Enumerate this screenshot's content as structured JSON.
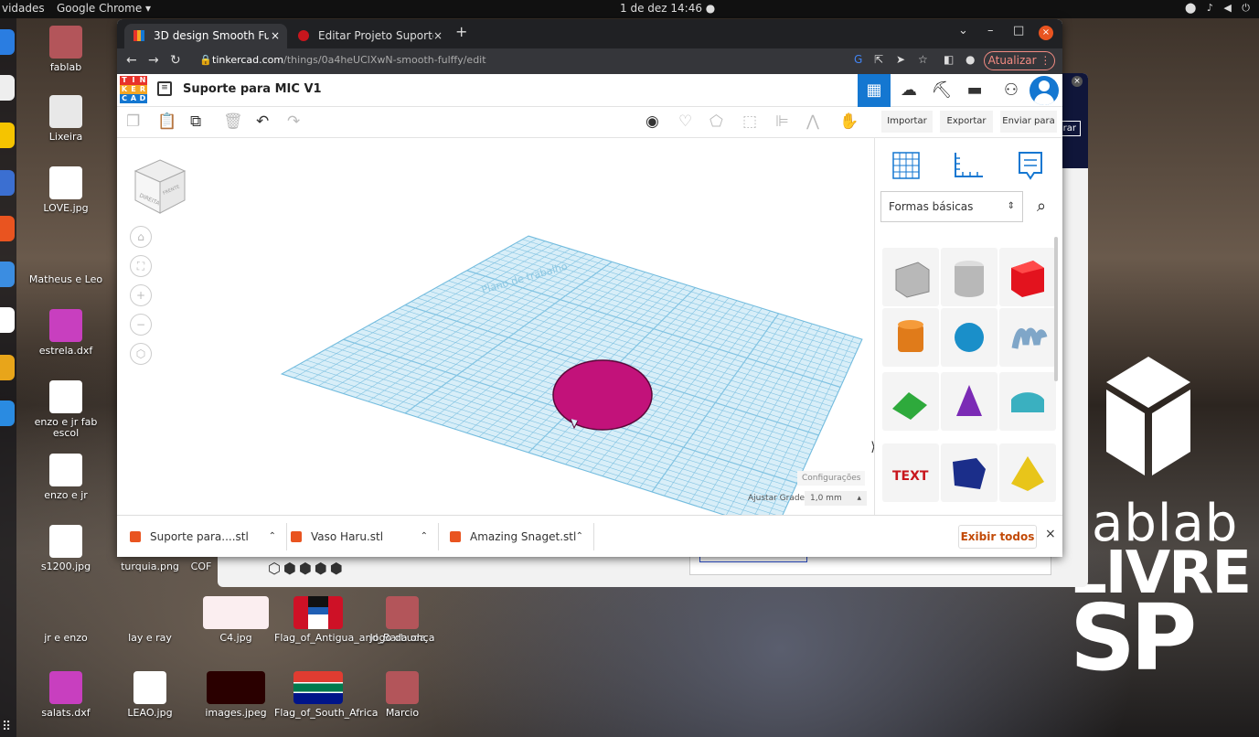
{
  "topbar": {
    "activities": "vidades",
    "app_menu": "Google Chrome ▾",
    "clock": "1 de dez  14:46  ●",
    "sys_icons": "⬤ ♪ ◀ ⏻"
  },
  "desktop_icons": [
    {
      "label": "fablab"
    },
    {
      "label": "Lixeira"
    },
    {
      "label": "LOVE.jpg"
    },
    {
      "label": "Matheus e Leo"
    },
    {
      "label": "estrela.dxf"
    },
    {
      "label": "enzo e jr fab escol"
    },
    {
      "label": "enzo e jr"
    },
    {
      "label": "s1200.jpg"
    },
    {
      "label": "turquia.png"
    },
    {
      "label": "COF"
    },
    {
      "label": "jr e enzo"
    },
    {
      "label": "lay e ray"
    },
    {
      "label": "C4.jpg"
    },
    {
      "label": "Flag_of_Antigua_and_Barbuda"
    },
    {
      "label": "Jogo da onça"
    },
    {
      "label": "salats.dxf"
    },
    {
      "label": "LEAO.jpg"
    },
    {
      "label": "images.jpeg"
    },
    {
      "label": "Flag_of_South_Africa"
    },
    {
      "label": "Marcio"
    }
  ],
  "background_window": {
    "partial_button": "rar"
  },
  "browser": {
    "tabs": [
      {
        "label": "3D design Smooth Fulffy |",
        "close": "×"
      },
      {
        "label": "Editar Projeto Suporte pa",
        "close": "×"
      }
    ],
    "new_tab": "+",
    "window_controls": {
      "dropdown": "⌄",
      "minimize": "–",
      "maximize": "□",
      "close": "×"
    },
    "url_host": "tinkercad.com",
    "url_path": "/things/0a4heUClXwN-smooth-fulffy/edit",
    "update_button": "Atualizar ⋮"
  },
  "tinkercad": {
    "logo_letters": [
      "T",
      "I",
      "N",
      "K",
      "E",
      "R",
      "C",
      "A",
      "D"
    ],
    "design_title": "Suporte para MIC V1",
    "toolbar": {
      "import": "Importar",
      "export": "Exportar",
      "send_to": "Enviar para"
    },
    "workplane": {
      "settings": "Configurações",
      "snap_grid_label": "Ajustar Grade",
      "snap_grid_value": "1,0 mm",
      "grid_watermark": "Plano de trabalho"
    },
    "viewcube": {
      "front": "DIREITA",
      "side": "FRENTE",
      "top": "SUPERIOR"
    },
    "shapes_panel": {
      "category": "Formas básicas",
      "shapes": [
        {
          "name": "Caixa listrada",
          "color": "#b8b8b8"
        },
        {
          "name": "Cilindro listrado",
          "color": "#b8b8b8"
        },
        {
          "name": "Caixa",
          "color": "#e3131e"
        },
        {
          "name": "Cilindro",
          "color": "#e07b1a"
        },
        {
          "name": "Esfera",
          "color": "#1a8fc9"
        },
        {
          "name": "Rabisco",
          "color": "#7fa6c8"
        },
        {
          "name": "Telhado",
          "color": "#2eaa3c"
        },
        {
          "name": "Cone",
          "color": "#7b2bb5"
        },
        {
          "name": "Meio cilindro",
          "color": "#3ab0c0"
        },
        {
          "name": "Texto",
          "color": "#c8161d"
        },
        {
          "name": "Polígono",
          "color": "#1b2e8a"
        },
        {
          "name": "Pirâmide",
          "color": "#e8c51a"
        }
      ]
    },
    "object_color": "#c2127a"
  },
  "downloads": {
    "items": [
      {
        "name": "Suporte para....stl"
      },
      {
        "name": "Vaso Haru.stl"
      },
      {
        "name": "Amazing Snaget.stl"
      }
    ],
    "show_all": "Exibir todos",
    "close": "×"
  },
  "brand": {
    "line1": "ablab",
    "line2": "LIVRE",
    "line3": "SP"
  }
}
